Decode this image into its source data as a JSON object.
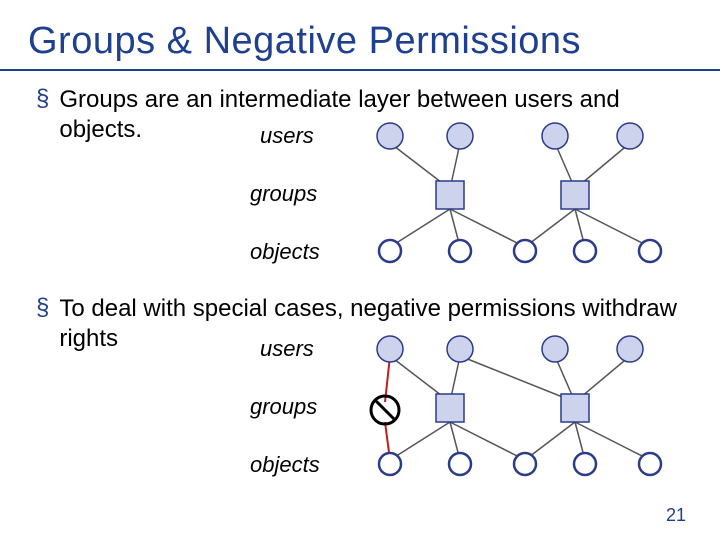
{
  "title": "Groups & Negative Permissions",
  "bullets": [
    "Groups are an intermediate layer between users and objects.",
    "To deal with special cases, negative permissions withdraw rights"
  ],
  "labels": {
    "users": "users",
    "groups": "groups",
    "objects": "objects"
  },
  "page_number": "21",
  "colors": {
    "heading": "#1f3f8f",
    "node_fill": "#cdd3ec",
    "node_stroke": "#2b3b8c",
    "line": "#555",
    "neg": "#c11d1d"
  }
}
